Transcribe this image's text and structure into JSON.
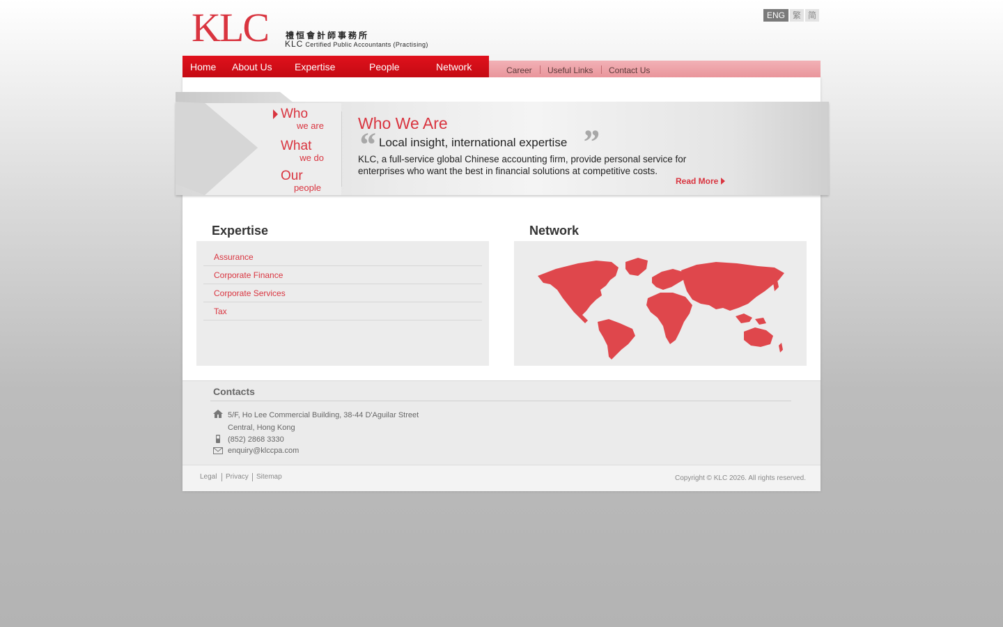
{
  "logo": {
    "mark": "KLC",
    "chinese_name": "禮恒會計師事務所",
    "english_abbr": "KLC",
    "english_name": "Certified Public Accountants (Practising)"
  },
  "language": {
    "options": [
      "ENG",
      "繁",
      "简"
    ],
    "active": "ENG"
  },
  "main_nav": [
    "Home",
    "About Us",
    "Expertise",
    "People",
    "Network"
  ],
  "sub_nav": [
    "Career",
    "Useful Links",
    "Contact Us"
  ],
  "banner": {
    "nav": [
      {
        "big": "Who",
        "small": "we are"
      },
      {
        "big": "What",
        "small": "we do"
      },
      {
        "big": "Our",
        "small": "people"
      }
    ],
    "title": "Who We Are",
    "open_quote": "“",
    "close_quote": "”",
    "subtitle": "Local insight, international expertise",
    "body": "KLC, a full-service global Chinese accounting firm, provide personal service for enterprises who want the best in financial solutions at competitive costs.",
    "read_more": "Read More"
  },
  "expertise": {
    "title": "Expertise",
    "items": [
      "Assurance",
      "Corporate Finance",
      "Corporate Services",
      "Tax"
    ]
  },
  "network": {
    "title": "Network",
    "map_color": "#df474c"
  },
  "contacts": {
    "title": "Contacts",
    "address_line1": "5/F, Ho Lee Commercial Building, 38-44 D'Aguilar Street",
    "address_line2": "Central, Hong Kong",
    "phone": "(852) 2868 3330",
    "email": "enquiry@klccpa.com"
  },
  "footer": {
    "links": [
      "Legal",
      "Privacy",
      "Sitemap"
    ],
    "copyright": "Copyright © KLC 2026. All rights reserved."
  },
  "colors": {
    "brand_red": "#d9343f",
    "nav_red": "#d40f19",
    "subnav_pink": "#eea4aa"
  }
}
